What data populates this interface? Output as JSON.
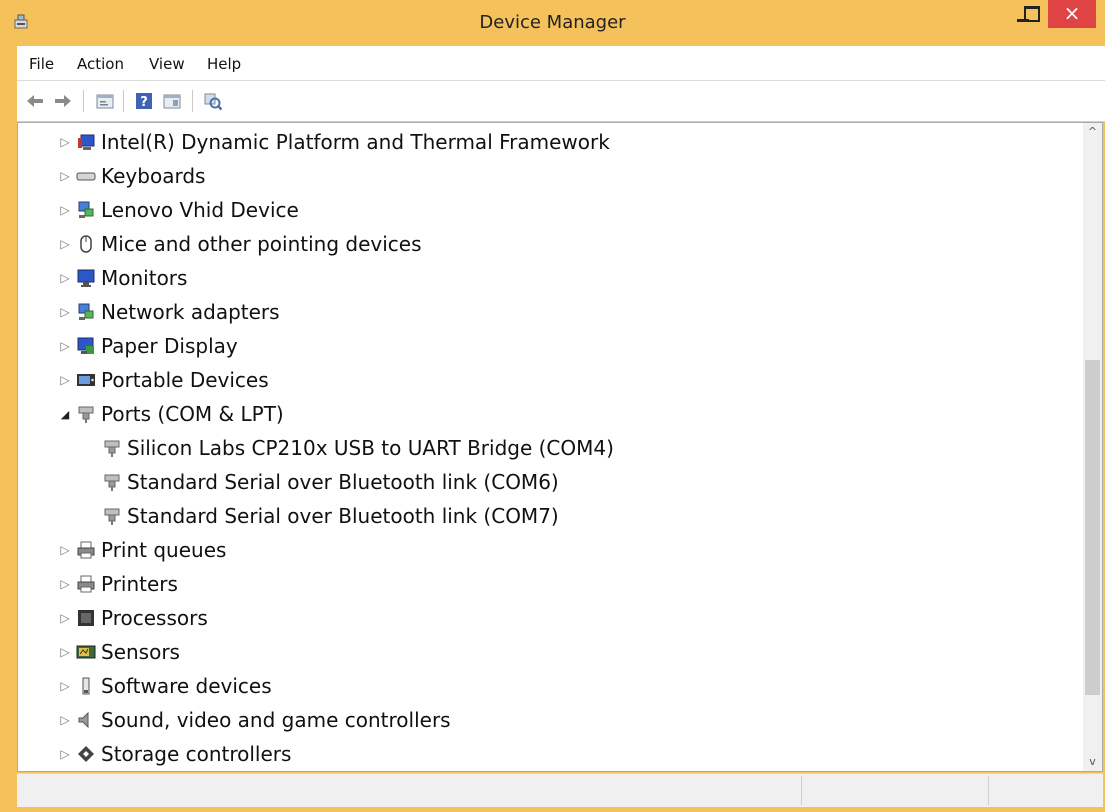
{
  "window": {
    "title": "Device Manager",
    "close_symbol": "×"
  },
  "menu": [
    "File",
    "Action",
    "View",
    "Help"
  ],
  "toolbar": [
    {
      "name": "back-icon"
    },
    {
      "name": "forward-icon"
    },
    {
      "name": "properties-icon"
    },
    {
      "name": "help-icon"
    },
    {
      "name": "view-icon"
    },
    {
      "name": "scan-hardware-icon"
    }
  ],
  "tree": [
    {
      "label": "Intel(R) Dynamic Platform and Thermal Framework",
      "icon": "thermal-framework-icon",
      "expanded": false,
      "level": 0
    },
    {
      "label": "Keyboards",
      "icon": "keyboard-icon",
      "expanded": false,
      "level": 0
    },
    {
      "label": "Lenovo Vhid Device",
      "icon": "network-device-icon",
      "expanded": false,
      "level": 0
    },
    {
      "label": "Mice and other pointing devices",
      "icon": "mouse-icon",
      "expanded": false,
      "level": 0
    },
    {
      "label": "Monitors",
      "icon": "monitor-icon",
      "expanded": false,
      "level": 0
    },
    {
      "label": "Network adapters",
      "icon": "network-adapter-icon",
      "expanded": false,
      "level": 0
    },
    {
      "label": "Paper Display",
      "icon": "paper-display-icon",
      "expanded": false,
      "level": 0
    },
    {
      "label": "Portable Devices",
      "icon": "portable-device-icon",
      "expanded": false,
      "level": 0
    },
    {
      "label": "Ports (COM & LPT)",
      "icon": "port-icon",
      "expanded": true,
      "level": 0
    },
    {
      "label": "Silicon Labs CP210x USB to UART Bridge (COM4)",
      "icon": "port-icon",
      "level": 1
    },
    {
      "label": "Standard Serial over Bluetooth link (COM6)",
      "icon": "port-icon",
      "level": 1
    },
    {
      "label": "Standard Serial over Bluetooth link (COM7)",
      "icon": "port-icon",
      "level": 1
    },
    {
      "label": "Print queues",
      "icon": "printer-icon",
      "expanded": false,
      "level": 0
    },
    {
      "label": "Printers",
      "icon": "printer-icon",
      "expanded": false,
      "level": 0
    },
    {
      "label": "Processors",
      "icon": "processor-icon",
      "expanded": false,
      "level": 0
    },
    {
      "label": "Sensors",
      "icon": "sensor-icon",
      "expanded": false,
      "level": 0
    },
    {
      "label": "Software devices",
      "icon": "software-device-icon",
      "expanded": false,
      "level": 0
    },
    {
      "label": "Sound, video and game controllers",
      "icon": "sound-icon",
      "expanded": false,
      "level": 0
    },
    {
      "label": "Storage controllers",
      "icon": "storage-icon",
      "expanded": false,
      "level": 0
    }
  ]
}
